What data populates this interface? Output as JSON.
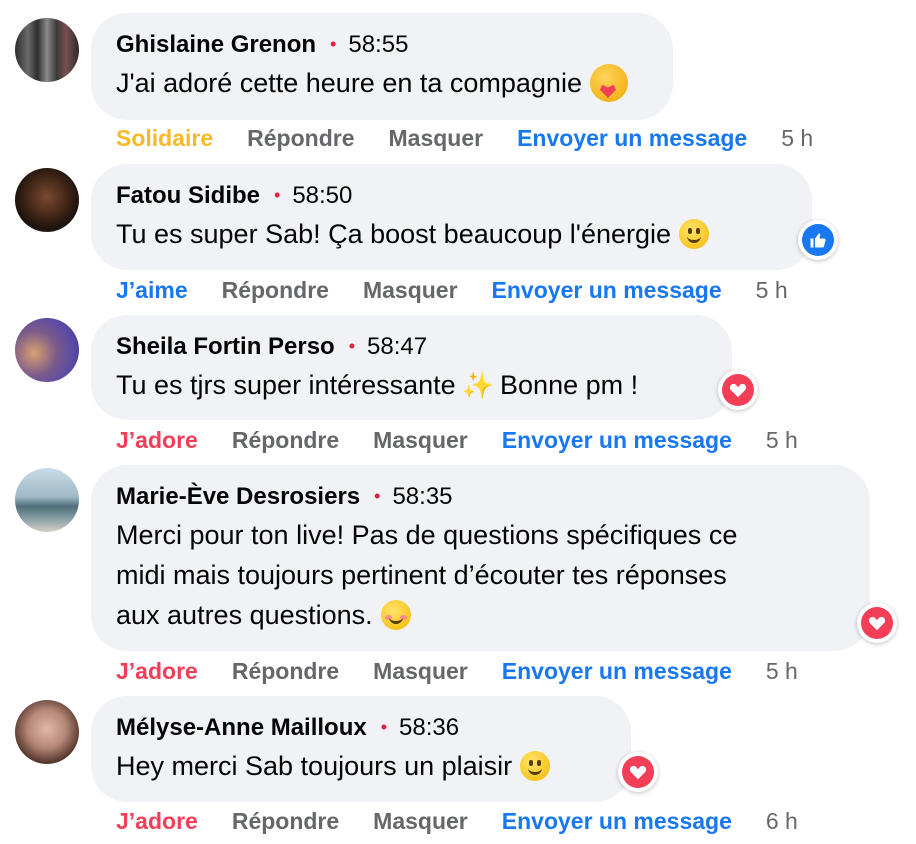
{
  "comments": [
    {
      "author": "Ghislaine Grenon",
      "timestamp": "58:55",
      "text": "J'ai adoré cette heure en ta compagnie",
      "emoji": "care-emoji",
      "reaction_label": "Solidaire",
      "reply_label": "Répondre",
      "hide_label": "Masquer",
      "message_label": "Envoyer un message",
      "age": "5 h"
    },
    {
      "author": "Fatou Sidibe",
      "timestamp": "58:50",
      "text": "Tu es super Sab! Ça boost beaucoup l'énergie",
      "emoji": "smile-emoji",
      "badge": "like-icon",
      "reaction_label": "J’aime",
      "reply_label": "Répondre",
      "hide_label": "Masquer",
      "message_label": "Envoyer un message",
      "age": "5 h"
    },
    {
      "author": "Sheila Fortin Perso",
      "timestamp": "58:47",
      "text_before": "Tu es tjrs super intéressante",
      "text_after": "Bonne pm !",
      "emoji": "sparkles-emoji",
      "badge": "love-icon",
      "reaction_label": "J’adore",
      "reply_label": "Répondre",
      "hide_label": "Masquer",
      "message_label": "Envoyer un message",
      "age": "5 h"
    },
    {
      "author": "Marie-Ève Desrosiers",
      "timestamp": "58:35",
      "text_line1": "Merci pour ton live! Pas de questions spécifiques ce",
      "text_line2": "midi mais toujours pertinent d’écouter tes réponses",
      "text_line3": "aux autres questions.",
      "emoji": "blush-emoji",
      "badge": "love-icon",
      "reaction_label": "J’adore",
      "reply_label": "Répondre",
      "hide_label": "Masquer",
      "message_label": "Envoyer un message",
      "age": "5 h"
    },
    {
      "author": "Mélyse-Anne Mailloux",
      "timestamp": "58:36",
      "text": "Hey merci Sab toujours un plaisir",
      "emoji": "smile-emoji",
      "badge": "love-icon",
      "reaction_label": "J’adore",
      "reply_label": "Répondre",
      "hide_label": "Masquer",
      "message_label": "Envoyer un message",
      "age": "6 h"
    }
  ],
  "colors": {
    "bubble": "#f0f2f5",
    "solidaire": "#f7b928",
    "jaime": "#1877f2",
    "jadore": "#f33e58",
    "muted": "#65676b",
    "dot": "#e41e3f"
  }
}
